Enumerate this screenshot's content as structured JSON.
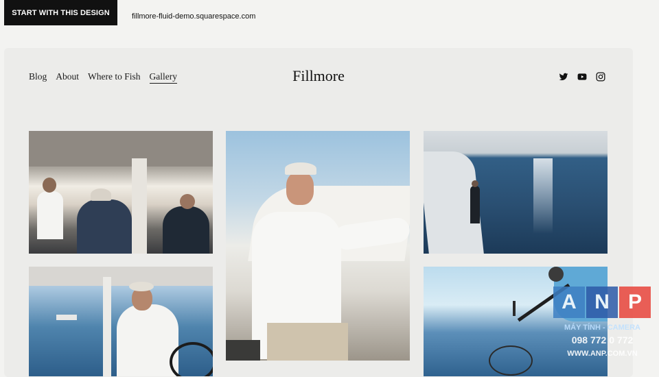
{
  "top_bar": {
    "start_button_label": "START WITH THIS DESIGN",
    "site_url": "fillmore-fluid-demo.squarespace.com"
  },
  "site": {
    "title": "Fillmore",
    "nav": [
      {
        "label": "Blog"
      },
      {
        "label": "About"
      },
      {
        "label": "Where to Fish"
      },
      {
        "label": "Gallery",
        "active": true
      }
    ],
    "social_icons": [
      "twitter-icon",
      "youtube-icon",
      "instagram-icon"
    ]
  },
  "gallery": {
    "images": [
      "boat-cabin-three-men-fishing",
      "smiling-man-white-shirt-on-boat",
      "angler-casting-from-bow-at-sunset",
      "man-driving-boat-sunglasses",
      "diver-netting-fish"
    ]
  },
  "watermark": {
    "letters": [
      "A",
      "N",
      "P"
    ],
    "line1": "MÁY TÍNH - CAMERA",
    "line2": "098 772 0 772",
    "line3": "WWW.ANP.COM.VN",
    "colors": [
      "#3d7fc3",
      "#2d5aa8",
      "#e8453c"
    ]
  }
}
